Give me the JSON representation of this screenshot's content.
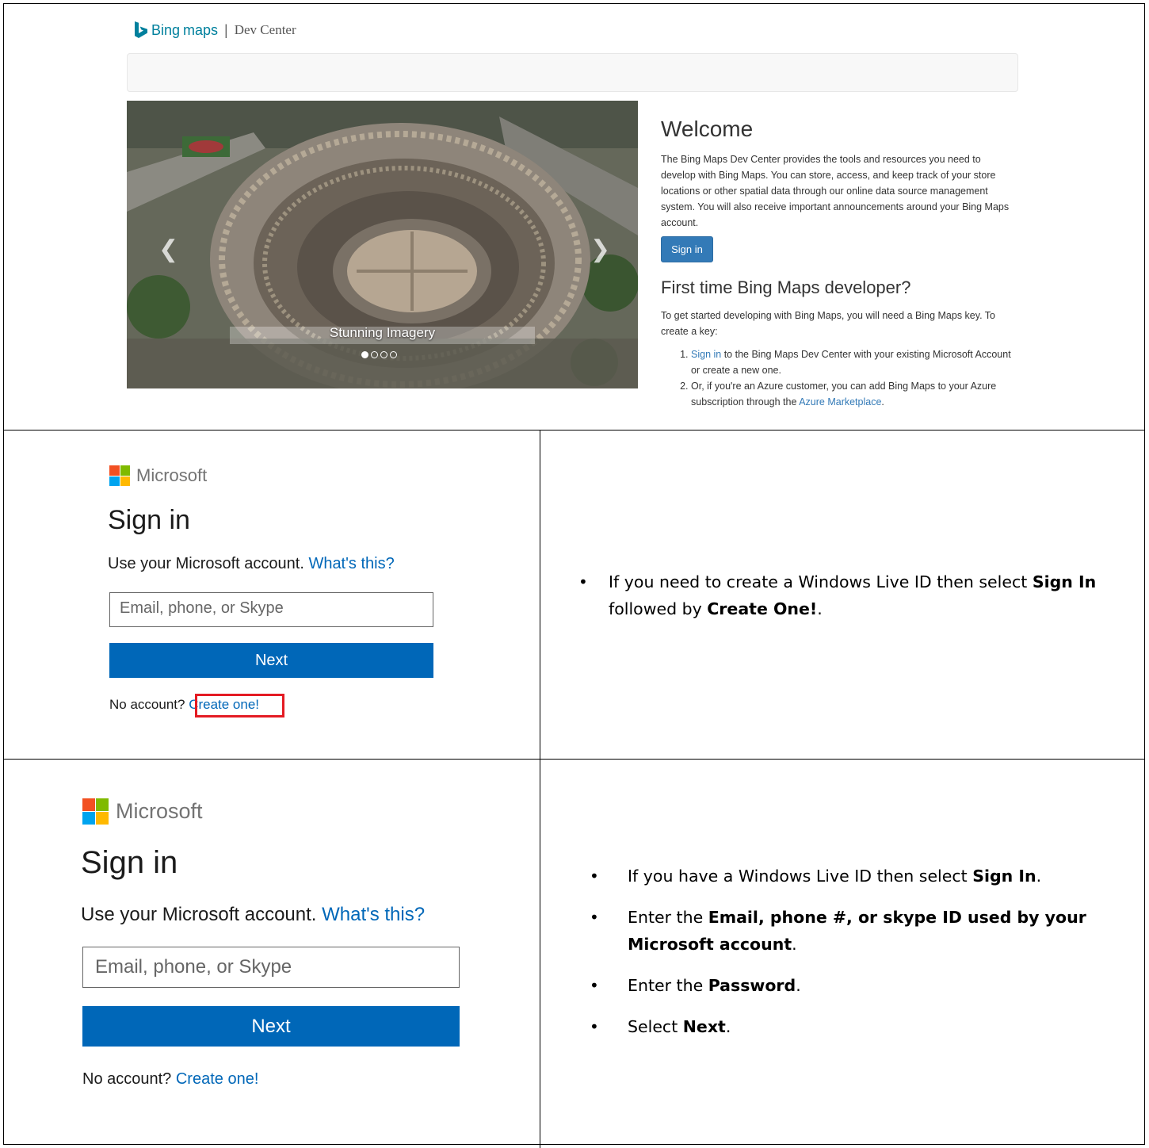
{
  "bing": {
    "brand_word": "Bing",
    "brand_maps": "maps",
    "separator": "|",
    "dev_center": "Dev Center",
    "carousel": {
      "caption": "Stunning Imagery"
    },
    "welcome_title": "Welcome",
    "welcome_text": "The Bing Maps Dev Center provides the tools and resources you need to develop with Bing Maps. You can store, access, and keep track of your store locations or other spatial data through our online data source management system. You will also receive important announcements around your Bing Maps account.",
    "sign_in_button": "Sign in",
    "first_time_title": "First time Bing Maps developer?",
    "getting_started": "To get started developing with Bing Maps, you will need a Bing Maps key. To create a key:",
    "step1_link": "Sign in",
    "step1_text": " to the Bing Maps Dev Center with your existing Microsoft Account or create a new one.",
    "step2_text": "Or, if you're an Azure customer, you can add Bing Maps to your Azure subscription through the ",
    "step2_link": "Azure Marketplace",
    "step2_end": "."
  },
  "ms_signin": {
    "brand": "Microsoft",
    "title": "Sign in",
    "use_account": "Use your Microsoft account.",
    "whats_this": "What's this?",
    "email_placeholder": "Email, phone, or Skype",
    "next_button": "Next",
    "no_account": "No account?",
    "create_one": "Create one!"
  },
  "instructions_row2": {
    "item1_a": "If you need to create a Windows Live ID then select ",
    "item1_b": "Sign In",
    "item1_c": " followed by ",
    "item1_d": "Create One!",
    "item1_e": "."
  },
  "instructions_row3": {
    "item1_a": "If you have a Windows Live ID then select ",
    "item1_b": "Sign In",
    "item1_c": ".",
    "item2_a": "Enter the ",
    "item2_b": "Email, phone #, or skype ID used by your Microsoft account",
    "item2_c": ".",
    "item3_a": "Enter the ",
    "item3_b": "Password",
    "item3_c": ".",
    "item4_a": "Select ",
    "item4_b": "Next",
    "item4_c": "."
  },
  "colors": {
    "bing_teal": "#00809d",
    "bootstrap_primary": "#337ab7",
    "ms_blue": "#0067b8",
    "highlight_red": "#e41b23",
    "ms_red": "#f25022",
    "ms_green": "#7fba00",
    "ms_blue_square": "#00a4ef",
    "ms_yellow": "#ffb900"
  }
}
